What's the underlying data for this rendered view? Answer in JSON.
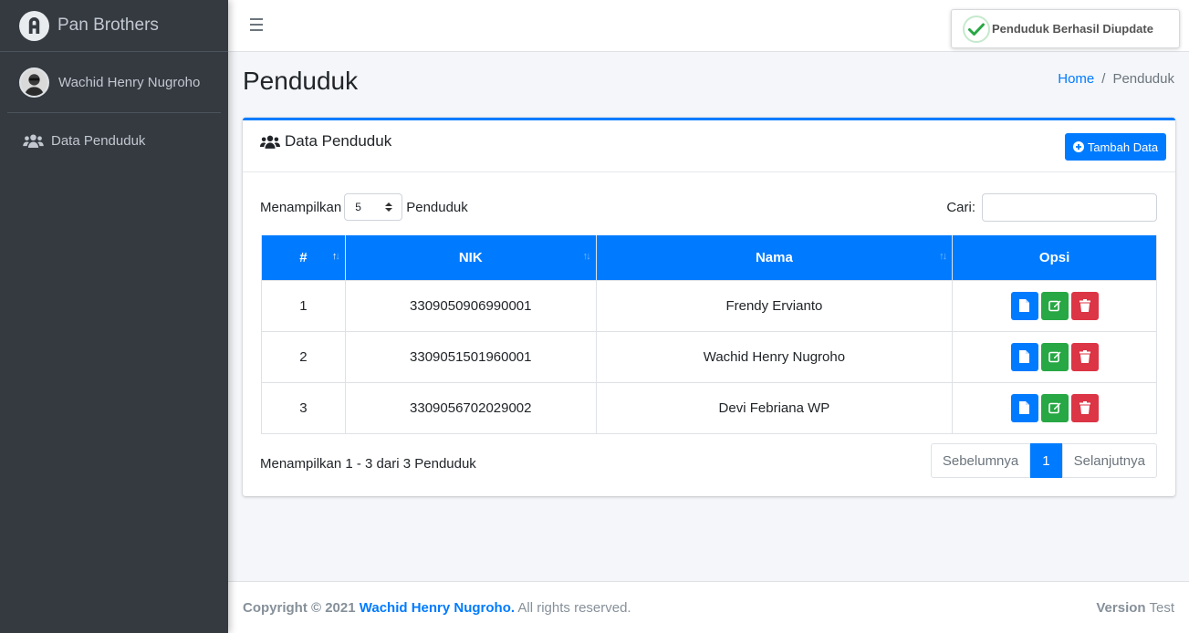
{
  "brand": {
    "name": "Pan Brothers"
  },
  "user": {
    "name": "Wachid Henry Nugroho"
  },
  "sidebar": {
    "items": [
      {
        "label": "Data Penduduk",
        "icon": "users-icon"
      }
    ]
  },
  "toast": {
    "message": "Penduduk Berhasil Diupdate",
    "icon": "check-icon"
  },
  "page": {
    "title": "Penduduk"
  },
  "breadcrumb": {
    "home": "Home",
    "separator": "/",
    "current": "Penduduk"
  },
  "card": {
    "title": "Data Penduduk",
    "add_button": "Tambah Data",
    "length_prefix": "Menampilkan",
    "length_value": "5",
    "length_suffix": "Penduduk",
    "search_label": "Cari:",
    "search_value": ""
  },
  "table": {
    "headers": [
      "#",
      "NIK",
      "Nama",
      "Opsi"
    ],
    "rows": [
      {
        "no": "1",
        "nik": "3309050906990001",
        "nama": "Frendy Ervianto"
      },
      {
        "no": "2",
        "nik": "3309051501960001",
        "nama": "Wachid Henry Nugroho"
      },
      {
        "no": "3",
        "nik": "3309056702029002",
        "nama": "Devi Febriana WP"
      }
    ]
  },
  "pagination": {
    "info": "Menampilkan 1 - 3 dari 3 Penduduk",
    "prev": "Sebelumnya",
    "current": "1",
    "next": "Selanjutnya"
  },
  "footer": {
    "copyright_prefix": "Copyright © 2021",
    "author": "Wachid Henry Nugroho.",
    "rights": "All rights reserved.",
    "version_label": "Version",
    "version_value": "Test"
  },
  "colors": {
    "primary": "#007bff",
    "success": "#28a745",
    "danger": "#dc3545",
    "sidebar": "#343a40"
  }
}
